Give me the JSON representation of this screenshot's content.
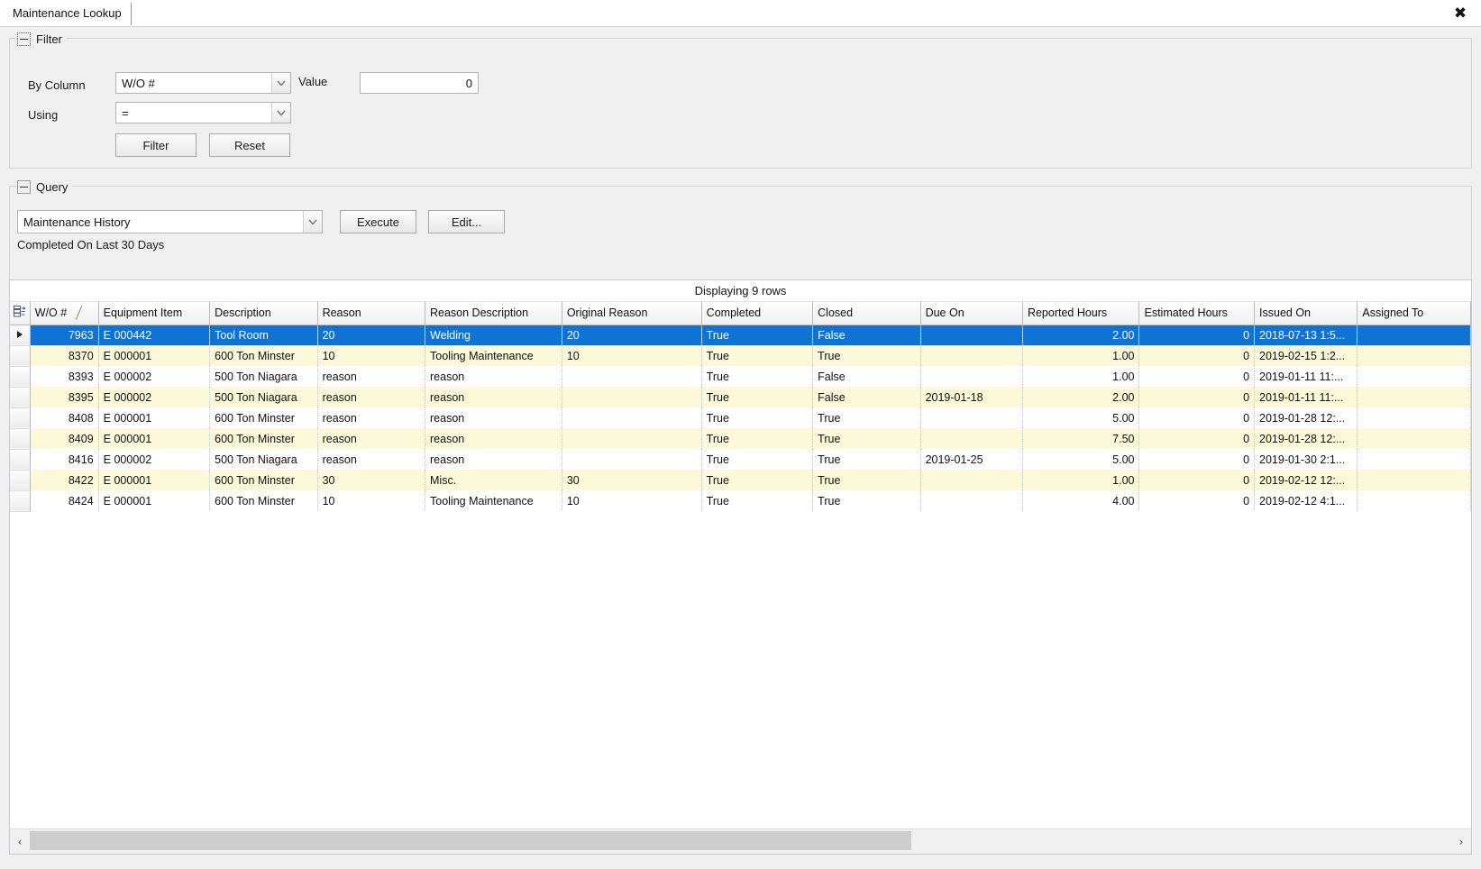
{
  "window": {
    "tab_label": "Maintenance Lookup",
    "close_icon": "close-icon",
    "close_glyph": "✖"
  },
  "filter": {
    "title": "Filter",
    "by_column_label": "By Column",
    "by_column_value": "W/O #",
    "value_label": "Value",
    "value_input": "0",
    "using_label": "Using",
    "using_value": "=",
    "filter_button": "Filter",
    "reset_button": "Reset"
  },
  "query": {
    "title": "Query",
    "selected": "Maintenance History",
    "execute_button": "Execute",
    "edit_button": "Edit...",
    "subtitle": "Completed On Last 30 Days"
  },
  "grid": {
    "caption": "Displaying 9 rows",
    "sort_column": "W/O #",
    "sort_direction": "ascending",
    "sort_glyph": "╱",
    "select_all_icon": "select-all-grid-icon",
    "current_row_icon": "current-row-arrow-icon",
    "columns": [
      "W/O #",
      "Equipment Item",
      "Description",
      "Reason",
      "Reason Description",
      "Original Reason",
      "Completed",
      "Closed",
      "Due On",
      "Reported Hours",
      "Estimated Hours",
      "Issued On",
      "Assigned To"
    ],
    "rows": [
      {
        "selected": true,
        "current": true,
        "wo": "7963",
        "equipment_item": "E 000442",
        "description": "Tool Room",
        "reason": "20",
        "reason_description": "Welding",
        "original_reason": "20",
        "completed": "True",
        "closed": "False",
        "due_on": "",
        "reported_hours": "2.00",
        "estimated_hours": "0",
        "issued_on": "2018-07-13  1:5...",
        "assigned_to": ""
      },
      {
        "selected": false,
        "current": false,
        "wo": "8370",
        "equipment_item": "E 000001",
        "description": "600 Ton Minster",
        "reason": "10",
        "reason_description": "Tooling Maintenance",
        "original_reason": "10",
        "completed": "True",
        "closed": "True",
        "due_on": "",
        "reported_hours": "1.00",
        "estimated_hours": "0",
        "issued_on": "2019-02-15  1:2...",
        "assigned_to": ""
      },
      {
        "selected": false,
        "current": false,
        "wo": "8393",
        "equipment_item": "E 000002",
        "description": "500 Ton Niagara",
        "reason": "reason",
        "reason_description": "reason",
        "original_reason": "",
        "completed": "True",
        "closed": "False",
        "due_on": "",
        "reported_hours": "1.00",
        "estimated_hours": "0",
        "issued_on": "2019-01-11  11:...",
        "assigned_to": ""
      },
      {
        "selected": false,
        "current": false,
        "wo": "8395",
        "equipment_item": "E 000002",
        "description": "500 Ton Niagara",
        "reason": "reason",
        "reason_description": "reason",
        "original_reason": "",
        "completed": "True",
        "closed": "False",
        "due_on": "2019-01-18",
        "reported_hours": "2.00",
        "estimated_hours": "0",
        "issued_on": "2019-01-11  11:...",
        "assigned_to": ""
      },
      {
        "selected": false,
        "current": false,
        "wo": "8408",
        "equipment_item": "E 000001",
        "description": "600 Ton Minster",
        "reason": "reason",
        "reason_description": "reason",
        "original_reason": "",
        "completed": "True",
        "closed": "True",
        "due_on": "",
        "reported_hours": "5.00",
        "estimated_hours": "0",
        "issued_on": "2019-01-28  12:...",
        "assigned_to": ""
      },
      {
        "selected": false,
        "current": false,
        "wo": "8409",
        "equipment_item": "E 000001",
        "description": "600 Ton Minster",
        "reason": "reason",
        "reason_description": "reason",
        "original_reason": "",
        "completed": "True",
        "closed": "True",
        "due_on": "",
        "reported_hours": "7.50",
        "estimated_hours": "0",
        "issued_on": "2019-01-28  12:...",
        "assigned_to": ""
      },
      {
        "selected": false,
        "current": false,
        "wo": "8416",
        "equipment_item": "E 000002",
        "description": "500 Ton Niagara",
        "reason": "reason",
        "reason_description": "reason",
        "original_reason": "",
        "completed": "True",
        "closed": "True",
        "due_on": "2019-01-25",
        "reported_hours": "5.00",
        "estimated_hours": "0",
        "issued_on": "2019-01-30  2:1...",
        "assigned_to": ""
      },
      {
        "selected": false,
        "current": false,
        "wo": "8422",
        "equipment_item": "E 000001",
        "description": "600 Ton Minster",
        "reason": "30",
        "reason_description": "Misc.",
        "original_reason": "30",
        "completed": "True",
        "closed": "True",
        "due_on": "",
        "reported_hours": "1.00",
        "estimated_hours": "0",
        "issued_on": "2019-02-12  12:...",
        "assigned_to": ""
      },
      {
        "selected": false,
        "current": false,
        "wo": "8424",
        "equipment_item": "E 000001",
        "description": "600 Ton Minster",
        "reason": "10",
        "reason_description": "Tooling Maintenance",
        "original_reason": "10",
        "completed": "True",
        "closed": "True",
        "due_on": "",
        "reported_hours": "4.00",
        "estimated_hours": "0",
        "issued_on": "2019-02-12  4:1...",
        "assigned_to": ""
      }
    ]
  },
  "scrollbar": {
    "left_arrow": "‹",
    "right_arrow": "›"
  },
  "colors": {
    "selection_blue": "#0f72d4",
    "alt_row_yellow": "#fbf9d8",
    "panel_gray": "#f0f0f0"
  }
}
